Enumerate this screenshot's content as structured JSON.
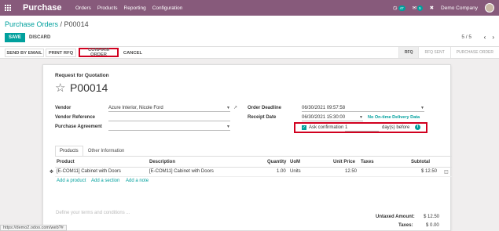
{
  "topbar": {
    "app_name": "Purchase",
    "menu": [
      "Orders",
      "Products",
      "Reporting",
      "Configuration"
    ],
    "activity_count": "47",
    "message_count": "5",
    "company": "Demo Company"
  },
  "control": {
    "breadcrumb_parent": "Purchase Orders",
    "breadcrumb_sep": " / ",
    "breadcrumb_current": "P00014",
    "save_label": "SAVE",
    "discard_label": "DISCARD",
    "pager": "5 / 5"
  },
  "statusbar": {
    "send_email": "SEND BY EMAIL",
    "print_rfq": "PRINT RFQ",
    "confirm_order": "CONFIRM ORDER",
    "cancel": "CANCEL",
    "states": [
      "RFQ",
      "RFQ SENT",
      "PURCHASE ORDER"
    ],
    "active_state": "RFQ"
  },
  "form": {
    "doc_type": "Request for Quotation",
    "name": "P00014",
    "vendor_label": "Vendor",
    "vendor_value": "Azure Interior, Nicole Ford",
    "vendor_ref_label": "Vendor Reference",
    "vendor_ref_value": "",
    "agreement_label": "Purchase Agreement",
    "agreement_value": "",
    "deadline_label": "Order Deadline",
    "deadline_value": "06/30/2021 09:57:58",
    "receipt_label": "Receipt Date",
    "receipt_value": "06/30/2021 15:30:00",
    "ontime_label": "No On-time Delivery Data",
    "ask_confirm_label": "Ask confirmation",
    "ask_confirm_value": "1",
    "ask_confirm_suffix": "day(s) before"
  },
  "notebook": {
    "tabs": [
      "Products",
      "Other Information"
    ],
    "active_tab": "Products",
    "columns": {
      "product": "Product",
      "description": "Description",
      "quantity": "Quantity",
      "uom": "UoM",
      "unit_price": "Unit Price",
      "taxes": "Taxes",
      "subtotal": "Subtotal"
    },
    "lines": [
      {
        "product": "[E-COM11] Cabinet with Doors",
        "description": "[E-COM11] Cabinet with Doors",
        "quantity": "1.00",
        "uom": "Units",
        "unit_price": "12.50",
        "taxes": "",
        "subtotal": "$ 12.50"
      }
    ],
    "add_product": "Add a product",
    "add_section": "Add a section",
    "add_note": "Add a note"
  },
  "footer": {
    "terms_placeholder": "Define your terms and conditions ...",
    "untaxed_label": "Untaxed Amount:",
    "untaxed_value": "$ 12.50",
    "taxes_label": "Taxes:",
    "taxes_value": "$ 0.00"
  },
  "status_url": "https://demo2.odoo.com/web?#"
}
